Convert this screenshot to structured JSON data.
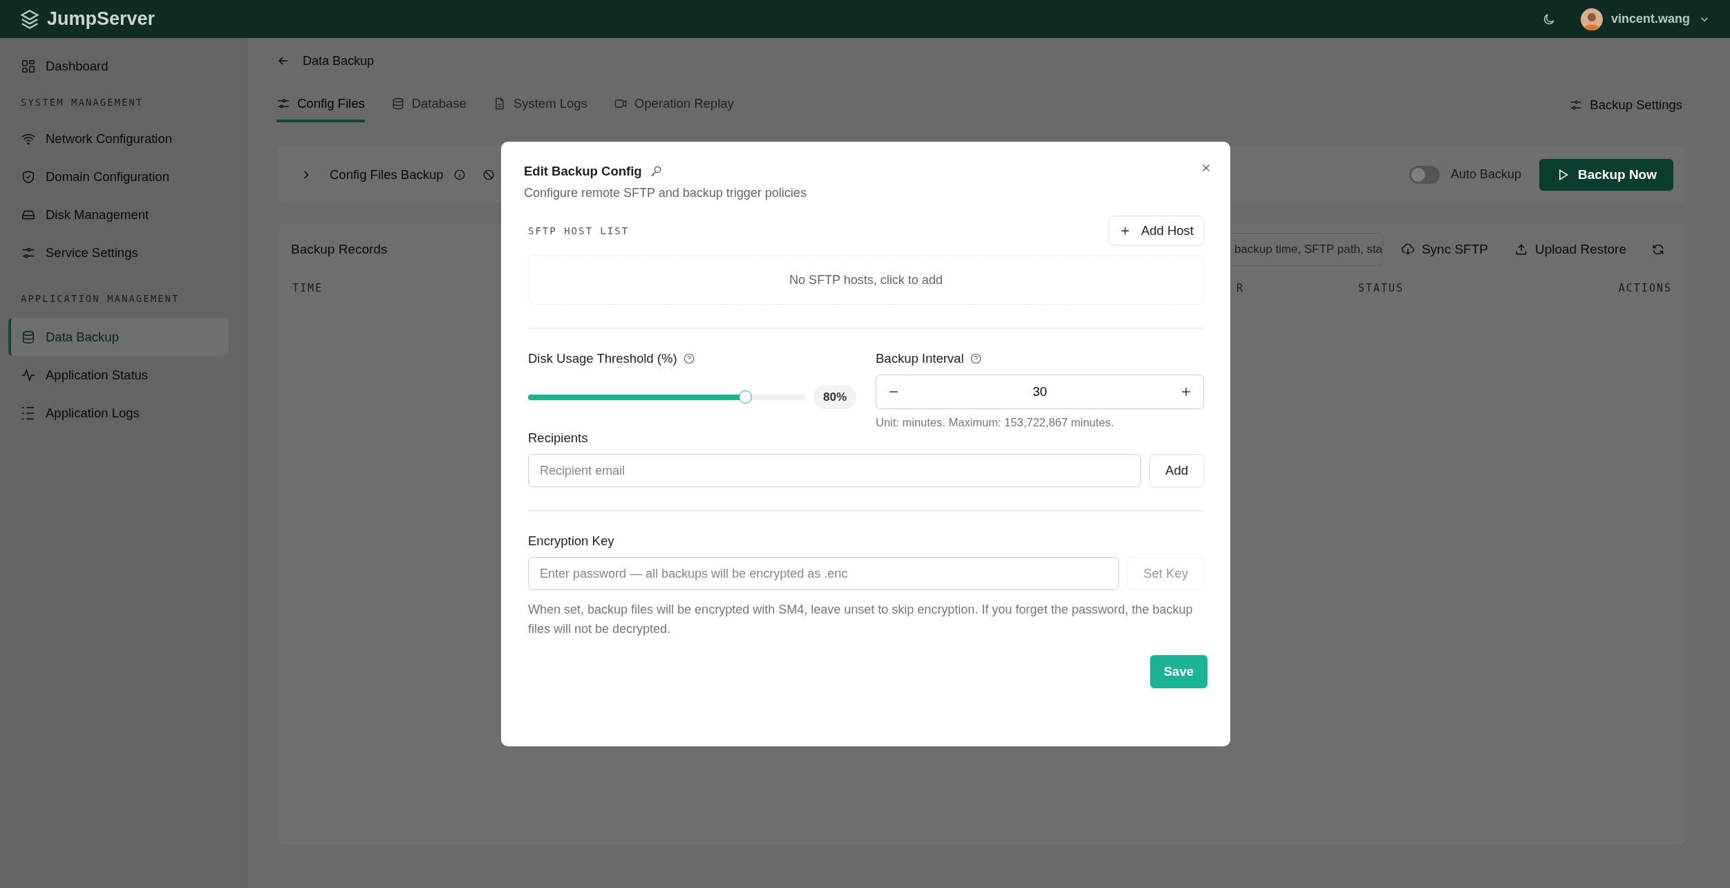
{
  "app": {
    "logo": "JumpServer",
    "user": "vincent.wang"
  },
  "sidebar": {
    "top": [
      {
        "label": "Dashboard",
        "selected": false
      }
    ],
    "sections": [
      {
        "heading": "SYSTEM MANAGEMENT",
        "items": [
          {
            "label": "Network Configuration",
            "selected": false
          },
          {
            "label": "Domain Configuration",
            "selected": false
          },
          {
            "label": "Disk Management",
            "selected": false
          },
          {
            "label": "Service Settings",
            "selected": false
          }
        ]
      },
      {
        "heading": "APPLICATION MANAGEMENT",
        "items": [
          {
            "label": "Data Backup",
            "selected": true
          },
          {
            "label": "Application Status",
            "selected": false
          },
          {
            "label": "Application Logs",
            "selected": false
          }
        ]
      }
    ]
  },
  "page": {
    "title": "Data Backup",
    "tabs": [
      {
        "label": "Config Files",
        "selected": true
      },
      {
        "label": "Database",
        "selected": false
      },
      {
        "label": "System Logs",
        "selected": false
      },
      {
        "label": "Operation Replay",
        "selected": false
      }
    ],
    "settings_button": "Backup Settings",
    "backup_card": {
      "title": "Config Files Backup",
      "auto_backup": {
        "label": "Auto Backup",
        "on": false
      },
      "backup_button": "Backup Now"
    },
    "records": {
      "title": "Backup Records",
      "search": {
        "placeholder": "backup time, SFTP path, sta"
      },
      "buttons": [
        "Sync SFTP",
        "Upload Restore"
      ],
      "columns": [
        "TIME",
        "R",
        "STATUS",
        "ACTIONS"
      ]
    }
  },
  "modal": {
    "title": "Edit Backup Config",
    "subtitle": "Configure remote SFTP and backup trigger policies",
    "sftp": {
      "heading": "SFTP HOST LIST",
      "add_button": "Add Host",
      "empty": "No SFTP hosts, click to add"
    },
    "threshold": {
      "label": "Disk Usage Threshold (%)",
      "level": 0.8,
      "reading": "80%"
    },
    "interval": {
      "label": "Backup Interval",
      "value": "30",
      "hint": "Unit: minutes. Maximum: 153,722,867 minutes."
    },
    "recipients": {
      "label": "Recipients",
      "placeholder": "Recipient email",
      "button": "Add"
    },
    "encryption": {
      "label": "Encryption Key",
      "placeholder": "Enter password — all backups will be encrypted as .enc",
      "button": "Set Key",
      "disabled": true,
      "help": "When set, backup files will be encrypted with SM4, leave unset to skip encryption. If you forget the password, the backup files will not be decrypted."
    },
    "save_button": "Save"
  }
}
